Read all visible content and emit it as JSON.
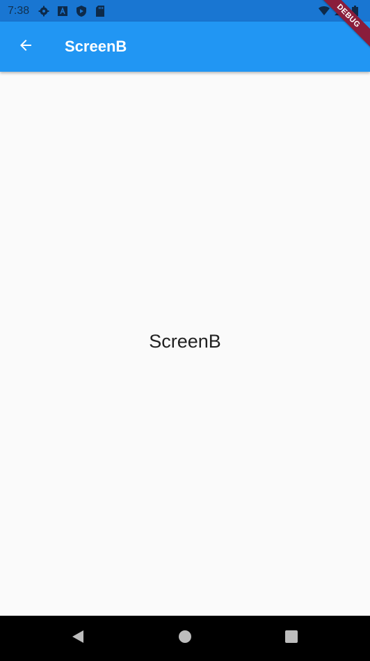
{
  "status_bar": {
    "time": "7:38",
    "left_icons": [
      "settings-icon",
      "a-box-icon",
      "shield-icon",
      "sd-card-icon"
    ],
    "right_icons": [
      "wifi-icon",
      "signal-icon",
      "battery-icon"
    ]
  },
  "app_bar": {
    "title": "ScreenB",
    "back_icon": "arrow-back-icon",
    "color": "#2196f3"
  },
  "debug_banner": {
    "label": "DEBUG",
    "color": "#8a1d3b"
  },
  "body": {
    "text": "ScreenB"
  },
  "nav_bar": {
    "buttons": [
      "back-triangle-icon",
      "home-circle-icon",
      "recents-square-icon"
    ]
  }
}
